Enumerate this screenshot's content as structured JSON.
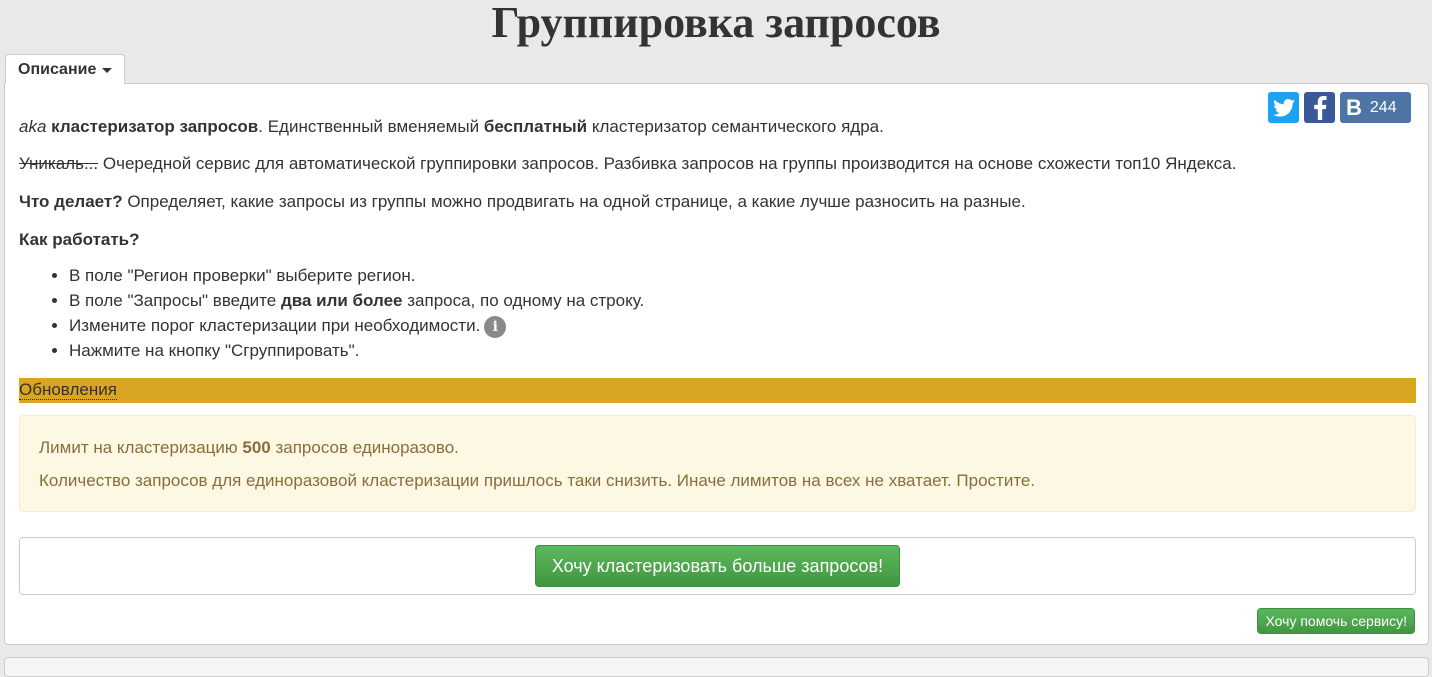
{
  "header": {
    "title": "Группировка запросов"
  },
  "tab": {
    "label": "Описание"
  },
  "share": {
    "vk_label": "В",
    "vk_count": "244"
  },
  "intro": {
    "aka": "aka",
    "bold_clusterer": "кластеризатор запросов",
    "text_a": ". Единственный вменяемый ",
    "bold_free": "бесплатный",
    "text_b": " кластеризатор семантического ядра."
  },
  "unique": {
    "strike": "Уникаль...",
    "text": " Очередной сервис для автоматической группировки запросов. Разбивка запросов на группы производится на основе схожести топ10 Яндекса."
  },
  "what": {
    "bold": "Что делает?",
    "text": " Определяет, какие запросы из группы можно продвигать на одной странице, а какие лучше разносить на разные."
  },
  "how": {
    "title": "Как работать?",
    "step1": "В поле \"Регион проверки\" выберите регион.",
    "step2_a": "В поле \"Запросы\" введите ",
    "step2_bold": "два или более",
    "step2_b": " запроса, по одному на строку.",
    "step3": "Измените порог кластеризации при необходимости.",
    "step4": "Нажмите на кнопку \"Сгруппировать\"."
  },
  "updates": {
    "label": "Обновления"
  },
  "notice": {
    "line1_a": "Лимит на кластеризацию ",
    "line1_bold": "500",
    "line1_b": " запросов единоразово.",
    "line2": "Количество запросов для единоразовой кластеризации пришлось таки снизить. Иначе лимитов на всех не хватает. Простите."
  },
  "actions": {
    "more_label": "Хочу кластеризовать больше запросов!",
    "help_label": "Хочу помочь сервису!"
  },
  "colors": {
    "updates_bar": "#daa520",
    "button_green": "#5cb85c",
    "twitter": "#1da1f2",
    "facebook": "#3b5998",
    "vk": "#4c75a3"
  }
}
